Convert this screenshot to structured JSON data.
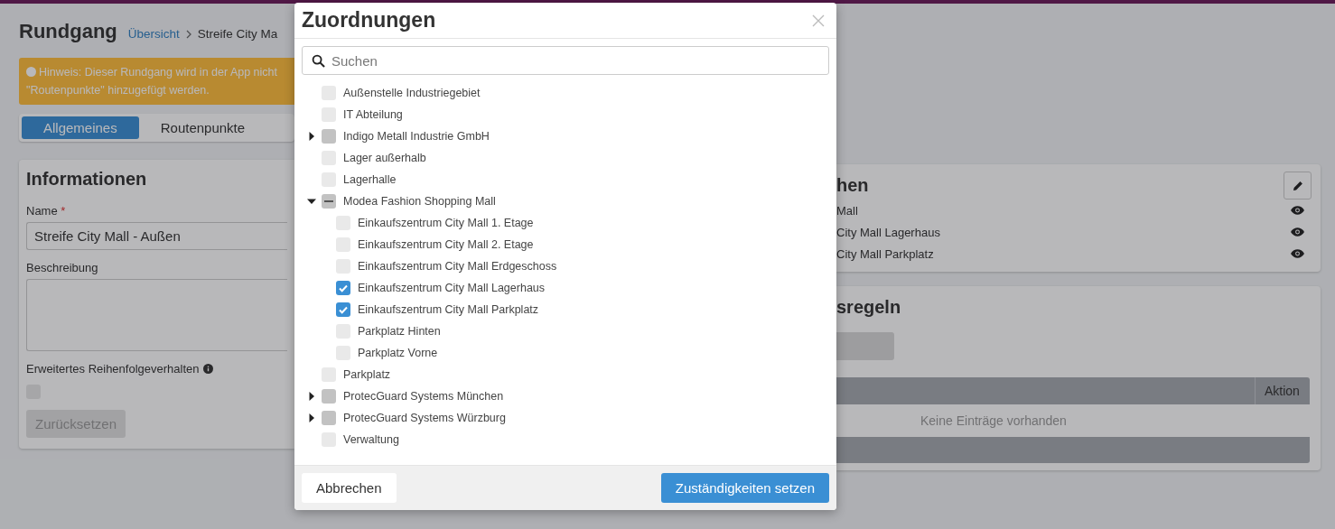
{
  "page": {
    "title": "Rundgang",
    "breadcrumb": [
      {
        "label": "Übersicht",
        "kind": "link"
      },
      {
        "label": "Streife City Ma",
        "kind": "current"
      }
    ]
  },
  "notice": {
    "lines": [
      "Hinweis: Dieser Rundgang wird in der App nicht",
      "\"Routenpunkte\" hinzugefügt werden."
    ]
  },
  "tabs": [
    {
      "label": "Allgemeines",
      "selected": true
    },
    {
      "label": "Routenpunkte",
      "selected": false
    }
  ],
  "info_card": {
    "title": "Informationen",
    "name_label": "Name",
    "required_mark": "*",
    "name_value": "Streife City Mall - Außen",
    "description_label": "Beschreibung",
    "order_label": "Erweitertes Reihenfolgeverhalten",
    "order_checked": false,
    "reset_button": {
      "label": "Zurücksetzen",
      "disabled": true
    }
  },
  "responsibilities_card": {
    "title": "hen",
    "items": [
      "Mall",
      "City Mall Lagerhaus",
      "City Mall Parkplatz"
    ]
  },
  "rules_card": {
    "title": "sregeln",
    "table": {
      "columns": [
        "Aktion"
      ],
      "empty_text": "Keine Einträge vorhanden"
    }
  },
  "dialog": {
    "title": "Zuordnungen",
    "search": {
      "placeholder": "Suchen"
    },
    "tree": [
      {
        "label": "Außenstelle Industriegebiet",
        "checked": false,
        "partial": false
      },
      {
        "label": "IT Abteilung",
        "checked": false,
        "partial": false
      },
      {
        "label": "Indigo Metall Industrie GmbH",
        "checked": false,
        "partial": false,
        "expanded": false
      },
      {
        "label": "Lager außerhalb",
        "checked": false,
        "partial": false
      },
      {
        "label": "Lagerhalle",
        "checked": false,
        "partial": false
      },
      {
        "label": "Modea Fashion Shopping Mall",
        "checked": false,
        "partial": true,
        "expanded": true,
        "children": [
          {
            "label": "Einkaufszentrum City Mall 1. Etage",
            "checked": false
          },
          {
            "label": "Einkaufszentrum City Mall 2. Etage",
            "checked": false
          },
          {
            "label": "Einkaufszentrum City Mall Erdgeschoss",
            "checked": false
          },
          {
            "label": "Einkaufszentrum City Mall Lagerhaus",
            "checked": true
          },
          {
            "label": "Einkaufszentrum City Mall Parkplatz",
            "checked": true
          },
          {
            "label": "Parkplatz Hinten",
            "checked": false
          },
          {
            "label": "Parkplatz Vorne",
            "checked": false
          }
        ]
      },
      {
        "label": "Parkplatz",
        "checked": false,
        "partial": false
      },
      {
        "label": "ProtecGuard Systems München",
        "checked": false,
        "partial": false,
        "expanded": false
      },
      {
        "label": "ProtecGuard Systems Würzburg",
        "checked": false,
        "partial": false,
        "expanded": false
      },
      {
        "label": "Verwaltung",
        "checked": false,
        "partial": false
      }
    ],
    "buttons": [
      {
        "label": "Abbrechen",
        "kind": "secondary"
      },
      {
        "label": "Zuständigkeiten setzen",
        "kind": "primary"
      }
    ]
  }
}
